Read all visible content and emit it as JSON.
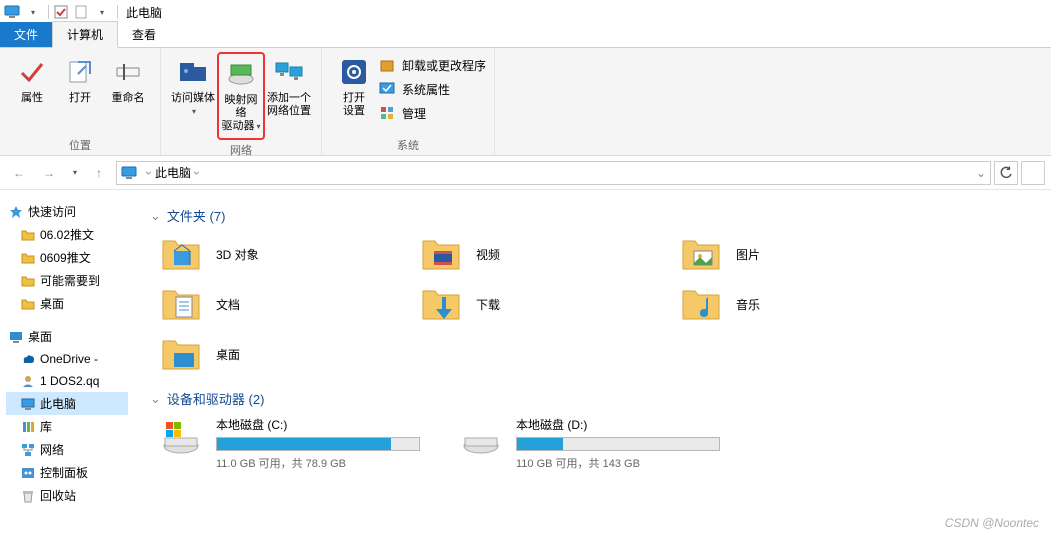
{
  "titlebar": {
    "title": "此电脑"
  },
  "tabs": {
    "file": "文件",
    "computer": "计算机",
    "view": "查看"
  },
  "ribbon": {
    "group_location": {
      "label": "位置",
      "properties": "属性",
      "open": "打开",
      "rename": "重命名"
    },
    "group_network": {
      "label": "网络",
      "access_media": "访问媒体",
      "map_drive_line1": "映射网络",
      "map_drive_line2": "驱动器",
      "add_net_line1": "添加一个",
      "add_net_line2": "网络位置"
    },
    "group_system": {
      "label": "系统",
      "open_settings_line1": "打开",
      "open_settings_line2": "设置",
      "uninstall": "卸载或更改程序",
      "sysprops": "系统属性",
      "manage": "管理"
    }
  },
  "address": {
    "location": "此电脑"
  },
  "navtree": {
    "quick": "快速访问",
    "quick_items": [
      "06.02推文",
      "0609推文",
      "可能需要到",
      "桌面"
    ],
    "desktop_root": "桌面",
    "desktop_items": [
      {
        "label": "OneDrive -",
        "icon": "onedrive"
      },
      {
        "label": "1 DOS2.qq",
        "icon": "user"
      },
      {
        "label": "此电脑",
        "icon": "pc",
        "selected": true
      },
      {
        "label": "库",
        "icon": "lib"
      },
      {
        "label": "网络",
        "icon": "net"
      },
      {
        "label": "控制面板",
        "icon": "cp"
      },
      {
        "label": "回收站",
        "icon": "bin"
      }
    ]
  },
  "content": {
    "folders_header": "文件夹 (7)",
    "folders": [
      {
        "label": "3D 对象",
        "icon": "3d"
      },
      {
        "label": "视频",
        "icon": "video"
      },
      {
        "label": "图片",
        "icon": "pic"
      },
      {
        "label": "文档",
        "icon": "doc"
      },
      {
        "label": "下载",
        "icon": "down"
      },
      {
        "label": "音乐",
        "icon": "music"
      },
      {
        "label": "桌面",
        "icon": "desk"
      }
    ],
    "drives_header": "设备和驱动器 (2)",
    "drives": [
      {
        "name": "本地磁盘 (C:)",
        "info": "11.0 GB 可用，共 78.9 GB",
        "fill": 86,
        "os": true
      },
      {
        "name": "本地磁盘 (D:)",
        "info": "110 GB 可用，共 143 GB",
        "fill": 23,
        "os": false
      }
    ]
  },
  "watermark": "CSDN @Noontec"
}
